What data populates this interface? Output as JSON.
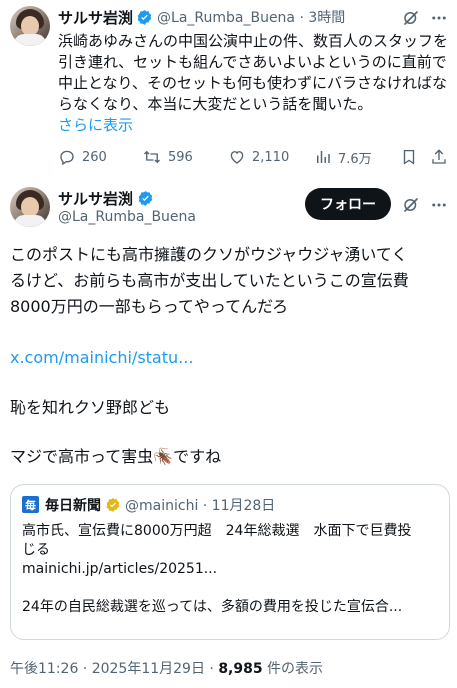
{
  "quoted_tweet": {
    "author_name": "サルサ岩渕",
    "handle_time": "@La_Rumba_Buena · 3時間",
    "text_lines": [
      "浜崎あゆみさんの中国公演中止の件、数百人のスタッフを",
      "引き連れ、セットも組んでさあいよいよというのに直前で",
      "中止となり、そのセットも何も使わずにバラさなければな",
      "らなくなり、本当に大変だという話を聞いた。"
    ],
    "show_more": "さらに表示",
    "replies": "260",
    "retweets": "596",
    "likes": "2,110",
    "views": "7.6万"
  },
  "main_tweet": {
    "author_name": "サルサ岩渕",
    "handle": "@La_Rumba_Buena",
    "follow_label": "フォロー",
    "text_lines": [
      "このポストにも高市擁護のクソがウジャウジャ湧いてく",
      "るけど、お前らも高市が支出していたというこの宣伝費",
      "8000万円の一部もらってやってんだろ"
    ],
    "link": "x.com/mainichi/statu...",
    "line2": "恥を知れクソ野郎ども",
    "line3": "マジで高市って害虫",
    "line3_emoji": "🪳",
    "line3_end": "ですね",
    "timestamp": "午後11:26 · 2025年11月29日 · ",
    "views_count": "8,985",
    "views_label": " 件の表示"
  },
  "embedded_card": {
    "source_name": "毎日新聞",
    "source_logo_text": "毎",
    "handle_date": "@mainichi · 11月28日",
    "headline_line1": "高市氏、宣伝費に8000万円超　24年総裁選　水面下で巨費投",
    "headline_line2": "じる",
    "url": "mainichi.jp/articles/20251...",
    "excerpt": "24年の自民総裁選を巡っては、多額の費用を投じた宣伝合..."
  },
  "colors": {
    "text": "#0f1419",
    "muted": "#536471",
    "link": "#1d9bf0",
    "verified": "#1d9bf0",
    "border": "#cfd9de",
    "mainichi_blue": "#1b6fd0",
    "gold_badge": "#e2b719"
  }
}
